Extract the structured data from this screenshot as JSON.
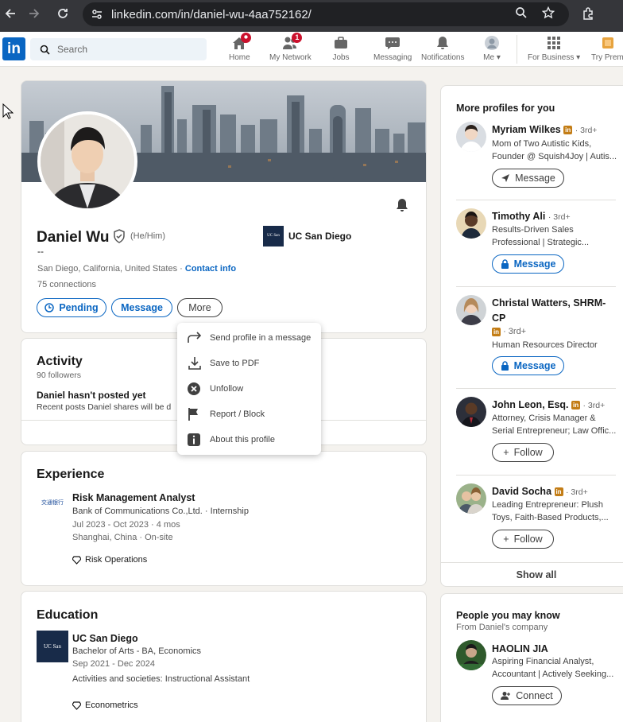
{
  "browser": {
    "url": "linkedin.com/in/daniel-wu-4aa752162/"
  },
  "nav": {
    "search_placeholder": "Search",
    "items": [
      {
        "label": "Home",
        "icon": "home-icon",
        "badge": ""
      },
      {
        "label": "My Network",
        "icon": "network-icon",
        "badge": "1"
      },
      {
        "label": "Jobs",
        "icon": "briefcase-icon",
        "badge": ""
      },
      {
        "label": "Messaging",
        "icon": "message-bubble-icon",
        "badge": ""
      },
      {
        "label": "Notifications",
        "icon": "bell-icon",
        "badge": ""
      },
      {
        "label": "Me",
        "icon": "avatar-icon",
        "badge": ""
      },
      {
        "label": "For Business",
        "icon": "grid-icon",
        "badge": ""
      },
      {
        "label": "Try Premi",
        "icon": "premium-icon",
        "badge": ""
      }
    ],
    "accent": "#0a66c2"
  },
  "profile": {
    "name": "Daniel Wu",
    "pronouns": "(He/Him)",
    "headline": "--",
    "location": "San Diego, California, United States",
    "contact_link": "Contact info",
    "connections": "75 connections",
    "school": "UC San Diego",
    "school_logo_text": "UC San Diego",
    "buttons": {
      "pending": "Pending",
      "message": "Message",
      "more": "More"
    }
  },
  "dropdown": {
    "items": [
      {
        "label": "Send profile in a message",
        "icon": "share-arrow-icon"
      },
      {
        "label": "Save to PDF",
        "icon": "download-icon"
      },
      {
        "label": "Unfollow",
        "icon": "unfollow-icon"
      },
      {
        "label": "Report / Block",
        "icon": "flag-icon"
      },
      {
        "label": "About this profile",
        "icon": "info-icon"
      }
    ]
  },
  "activity": {
    "title": "Activity",
    "followers": "90 followers",
    "empty_title": "Daniel hasn't posted yet",
    "empty_sub": "Recent posts Daniel shares will be d"
  },
  "experience": {
    "title": "Experience",
    "role": "Risk Management Analyst",
    "company": "Bank of Communications Co.,Ltd. · Internship",
    "dates": "Jul 2023 - Oct 2023 · 4 mos",
    "place": "Shanghai, China · On-site",
    "skill": "Risk Operations",
    "logo_text": "交通银行"
  },
  "education": {
    "title": "Education",
    "school": "UC San Diego",
    "degree": "Bachelor of Arts - BA, Economics",
    "dates": "Sep 2021 - Dec 2024",
    "activities": "Activities and societies: Instructional Assistant",
    "skill": "Econometrics",
    "logo_text": "UC San Diego"
  },
  "more_profiles": {
    "title": "More profiles for you",
    "show_all": "Show all",
    "people": [
      {
        "name": "Myriam Wilkes",
        "degree": "· 3rd+",
        "line1": "Mom of Two Autistic Kids,",
        "line2": "Founder @ Squish4Joy | Autis...",
        "button": "Message"
      },
      {
        "name": "Timothy Ali",
        "degree": "· 3rd+",
        "line1": "Results-Driven Sales",
        "line2": "Professional | Strategic...",
        "button": "Message"
      },
      {
        "name": "Christal Watters, SHRM-",
        "name2": "CP",
        "degree": "· 3rd+",
        "line1": "Human Resources Director",
        "button": "Message"
      },
      {
        "name": "John Leon, Esq.",
        "degree": "· 3rd+",
        "line1": "Attorney, Crisis Manager &",
        "line2": "Serial Entrepreneur; Law Offic...",
        "button": "Follow"
      },
      {
        "name": "David Socha",
        "degree": "· 3rd+",
        "line1": "Leading Entrepreneur: Plush",
        "line2": "Toys, Faith-Based Products,...",
        "button": "Follow"
      }
    ]
  },
  "people_know": {
    "title": "People you may know",
    "subtitle": "From Daniel's company",
    "person": {
      "name": "HAOLIN JIA",
      "line1": "Aspiring Financial Analyst,",
      "line2": "Accountant | Actively Seeking...",
      "button": "Connect"
    }
  }
}
